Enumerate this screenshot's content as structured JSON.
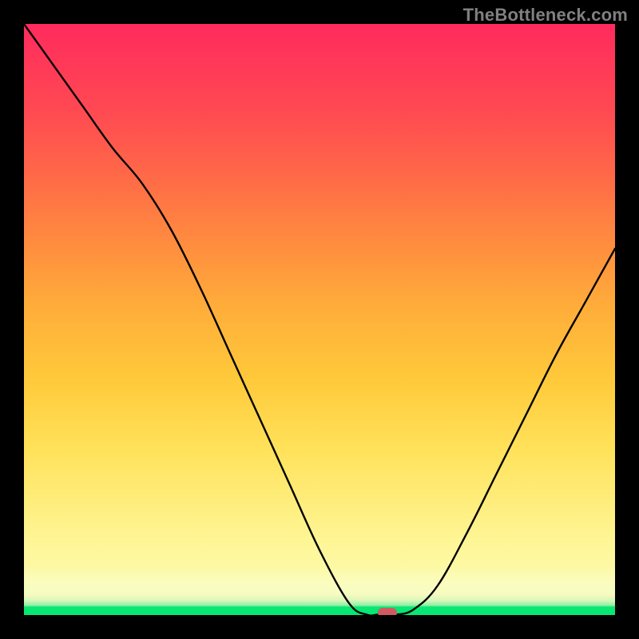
{
  "watermark": "TheBottleneck.com",
  "chart_data": {
    "type": "line",
    "title": "",
    "xlabel": "",
    "ylabel": "",
    "xlim": [
      0,
      1
    ],
    "ylim": [
      0,
      1
    ],
    "x": [
      0.0,
      0.05,
      0.1,
      0.15,
      0.2,
      0.25,
      0.3,
      0.35,
      0.4,
      0.45,
      0.5,
      0.55,
      0.58,
      0.6,
      0.63,
      0.66,
      0.7,
      0.75,
      0.8,
      0.85,
      0.9,
      0.95,
      1.0
    ],
    "values": [
      1.0,
      0.93,
      0.86,
      0.79,
      0.73,
      0.65,
      0.55,
      0.44,
      0.33,
      0.22,
      0.11,
      0.02,
      0.0,
      0.0,
      0.0,
      0.01,
      0.05,
      0.14,
      0.24,
      0.34,
      0.44,
      0.53,
      0.62
    ],
    "minimum_marker": {
      "x": 0.615,
      "y": 0.0
    },
    "grid": false,
    "legend": false,
    "background_gradient": {
      "stops": [
        {
          "pos": 0.0,
          "color": "#08e673"
        },
        {
          "pos": 0.02,
          "color": "#8df0a4"
        },
        {
          "pos": 0.05,
          "color": "#fbfdbe"
        },
        {
          "pos": 0.28,
          "color": "#ffe25a"
        },
        {
          "pos": 0.52,
          "color": "#ffad3a"
        },
        {
          "pos": 0.74,
          "color": "#ff6a47"
        },
        {
          "pos": 1.0,
          "color": "#ff2b5d"
        }
      ]
    },
    "marker_color": "#d15a62",
    "line_color": "#000000"
  }
}
